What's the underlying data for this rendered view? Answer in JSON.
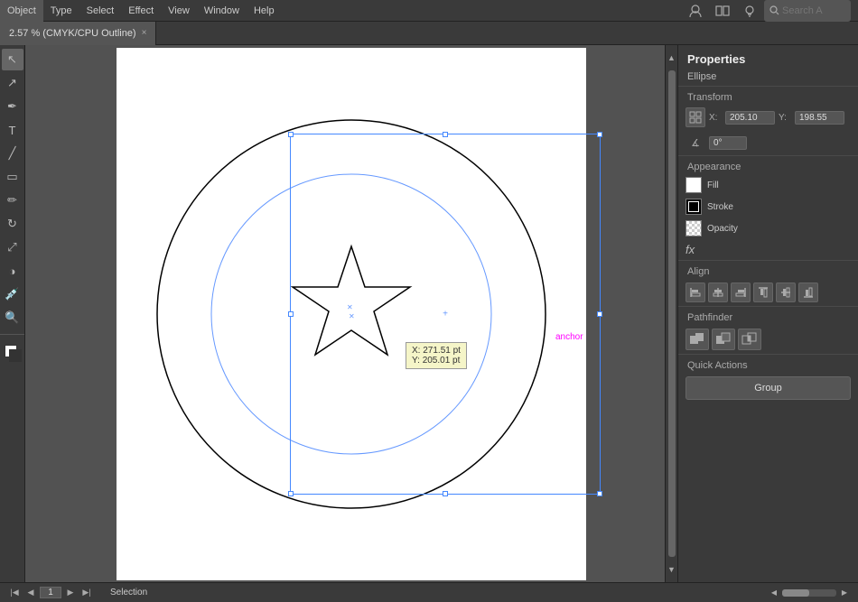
{
  "menubar": {
    "items": [
      "Object",
      "Type",
      "Select",
      "Effect",
      "View",
      "Window",
      "Help"
    ],
    "search_placeholder": "Search A"
  },
  "tab": {
    "label": "2.57 % (CMYK/CPU Outline)",
    "close": "×"
  },
  "canvas": {
    "tooltip": {
      "x_label": "X:",
      "x_value": "271.51 pt",
      "y_label": "Y:",
      "y_value": "205.01 pt"
    },
    "anchor_label": "anchor"
  },
  "properties": {
    "title": "Properties",
    "shape_label": "Ellipse",
    "transform": {
      "label": "Transform",
      "x_label": "X:",
      "x_value": "205.10",
      "y_label": "Y:",
      "y_value": "198.55",
      "rotation_label": "∡",
      "rotation_value": "0°"
    },
    "appearance": {
      "label": "Appearance",
      "fill_label": "Fill",
      "stroke_label": "Stroke",
      "opacity_label": "Opacity"
    },
    "fx_label": "fx",
    "align": {
      "label": "Align"
    },
    "pathfinder": {
      "label": "Pathfinder"
    },
    "quick_actions": {
      "label": "Quick Actions",
      "group_btn": "Group"
    }
  },
  "statusbar": {
    "page_num": "1",
    "tool_label": "Selection"
  }
}
